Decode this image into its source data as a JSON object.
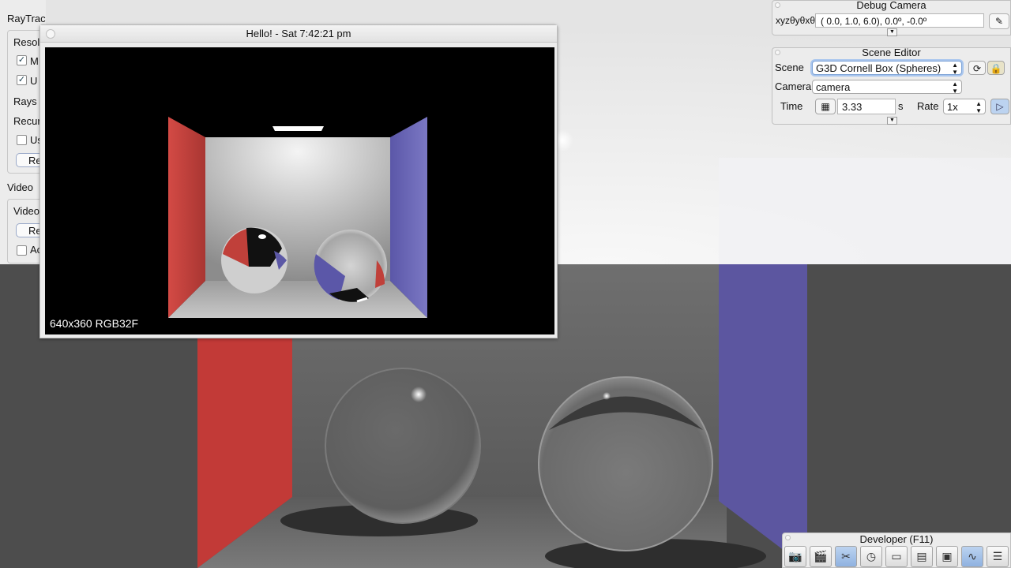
{
  "raytracer": {
    "title": "RayTracer",
    "resolution_label": "Resol",
    "check1_label": "M",
    "check2_label": "U",
    "rays_label": "Rays",
    "recursion_label": "Recur",
    "check3_label": "Us",
    "render_button": "Re",
    "video_header": "Video",
    "video_label": "Video",
    "video_button": "Re",
    "check4_label": "Ac"
  },
  "hello_window": {
    "title": "Hello! - Sat 7:42:21 pm",
    "caption": "640x360 RGB32F"
  },
  "debug_camera": {
    "title": "Debug Camera",
    "xyz_label": "xyzθyθxθz",
    "value": "(  0.0,   1.0,   6.0),   0.0º,  -0.0º"
  },
  "scene_editor": {
    "title": "Scene Editor",
    "scene_label": "Scene",
    "scene_value": "G3D Cornell Box (Spheres)",
    "camera_label": "Camera",
    "camera_value": "camera",
    "time_label": "Time",
    "time_value": "3.33",
    "time_unit": "s",
    "rate_label": "Rate",
    "rate_value": "1x"
  },
  "developer": {
    "title": "Developer (F11)",
    "tools": [
      "camera-icon",
      "clapperboard-icon",
      "tools-icon",
      "clock-icon",
      "new-note-icon",
      "terminal-icon",
      "scene-icon",
      "profiler-icon",
      "document-icon"
    ]
  },
  "colors": {
    "red_wall": "#c23a37",
    "blue_wall": "#5c56a0",
    "accent": "#8fb2e0"
  }
}
